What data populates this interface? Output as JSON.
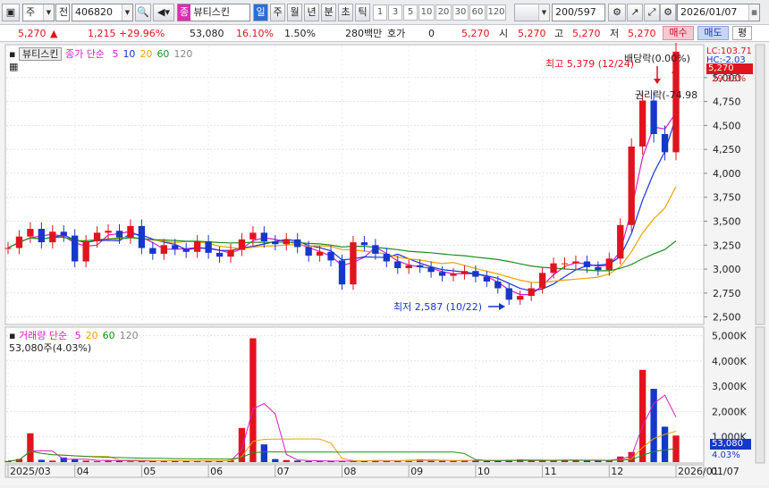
{
  "toolbar": {
    "type_select": "주",
    "market_select": "전",
    "code": "406820",
    "name_badge": "종",
    "name": "뷰티스킨",
    "period_tabs": [
      "일",
      "주",
      "월",
      "년",
      "분",
      "초",
      "틱"
    ],
    "active_period": "일",
    "intervals": [
      "1",
      "3",
      "5",
      "10",
      "20",
      "30",
      "60",
      "120"
    ],
    "count": "200",
    "total": "/597",
    "date": "2026/01/07"
  },
  "quote": {
    "price": "5,270",
    "change": "1,215",
    "change_rate": "+29.96%",
    "volume": "53,080",
    "turnover_rate": "16.10%",
    "ratio": "1.50%",
    "amount": "280백만",
    "hoga_label": "호가",
    "hoga_value": "0",
    "hoga_price": "5,270",
    "open_label": "시",
    "open": "5,270",
    "high_label": "고",
    "high": "5,270",
    "low_label": "저",
    "low": "5,270",
    "buy_label": "매수",
    "sell_label": "매도",
    "eval_label": "평"
  },
  "price_panel": {
    "stock_name": "뷰티스킨",
    "ma_title": "종가 단순",
    "ma_periods": [
      "5",
      "10",
      "20",
      "60",
      "120"
    ],
    "ma_colors": [
      "#d81ec8",
      "#1a2fe0",
      "#e8a400",
      "#1d8f1d",
      "#888888"
    ],
    "high_annotation": "최고 5,379 (12/24)",
    "low_annotation": "최저 2,587 (10/22)",
    "dividend_annotation": "배당락(0.00%)",
    "rights_annotation": "권리락(-74.98",
    "lc_text": "LC:103.71",
    "hc_text": "HC:-2.03",
    "current_price": "5,270",
    "current_pct": "29.93%",
    "y_ticks": [
      "5,000",
      "4,750",
      "4,500",
      "4,250",
      "4,000",
      "3,750",
      "3,500",
      "3,250",
      "3,000",
      "2,750",
      "2,500"
    ]
  },
  "volume_panel": {
    "title": "거래량",
    "ma_title": "단순",
    "ma_periods": [
      "5",
      "20",
      "60",
      "120"
    ],
    "current_volume": "53,080주(4.03%)",
    "y_ticks": [
      "5,000K",
      "4,000K",
      "3,000K",
      "2,000K",
      "1,000K"
    ],
    "current_value": "53,080",
    "current_pct": "4.03%"
  },
  "x_axis": {
    "labels": [
      "2025/03",
      "04",
      "05",
      "06",
      "07",
      "08",
      "09",
      "10",
      "11",
      "12",
      "2026/01"
    ],
    "right_label": "01/07"
  },
  "chart_data": {
    "type": "candlestick",
    "title": "뷰티스킨 (406820) 일봉",
    "x_start": "2025/03",
    "x_end": "2026/01/07",
    "ylim": [
      2450,
      5250
    ],
    "volume_ylim": [
      0,
      5200
    ],
    "volume_unit": "K",
    "high": {
      "value": 5379,
      "date": "12/24"
    },
    "low": {
      "value": 2587,
      "date": "10/22"
    },
    "last": {
      "close": 5270,
      "volume": 53080
    },
    "series": [
      {
        "name": "close",
        "values": [
          3220,
          3340,
          3420,
          3280,
          3390,
          3350,
          3080,
          3290,
          3380,
          3400,
          3330,
          3450,
          3220,
          3160,
          3250,
          3210,
          3180,
          3290,
          3170,
          3130,
          3200,
          3310,
          3380,
          3290,
          3260,
          3310,
          3230,
          3140,
          3180,
          3090,
          2840,
          3280,
          3250,
          3160,
          3080,
          3010,
          3040,
          3020,
          2970,
          2930,
          2950,
          2980,
          2920,
          2870,
          2800,
          2680,
          2720,
          2800,
          2960,
          3060,
          3060,
          3080,
          3020,
          2990,
          3110,
          3460,
          4280,
          4760,
          4410,
          4220,
          5270
        ]
      },
      {
        "name": "volume",
        "values": [
          40,
          120,
          1140,
          90,
          60,
          180,
          110,
          60,
          40,
          80,
          50,
          30,
          40,
          60,
          70,
          40,
          50,
          60,
          40,
          35,
          80,
          1350,
          4900,
          700,
          120,
          80,
          60,
          40,
          50,
          40,
          30,
          50,
          60,
          70,
          40,
          60,
          80,
          100,
          60,
          50,
          60,
          80,
          70,
          40,
          60,
          90,
          110,
          60,
          70,
          80,
          90,
          60,
          50,
          80,
          70,
          220,
          400,
          3650,
          2900,
          1400,
          1050
        ]
      }
    ]
  }
}
